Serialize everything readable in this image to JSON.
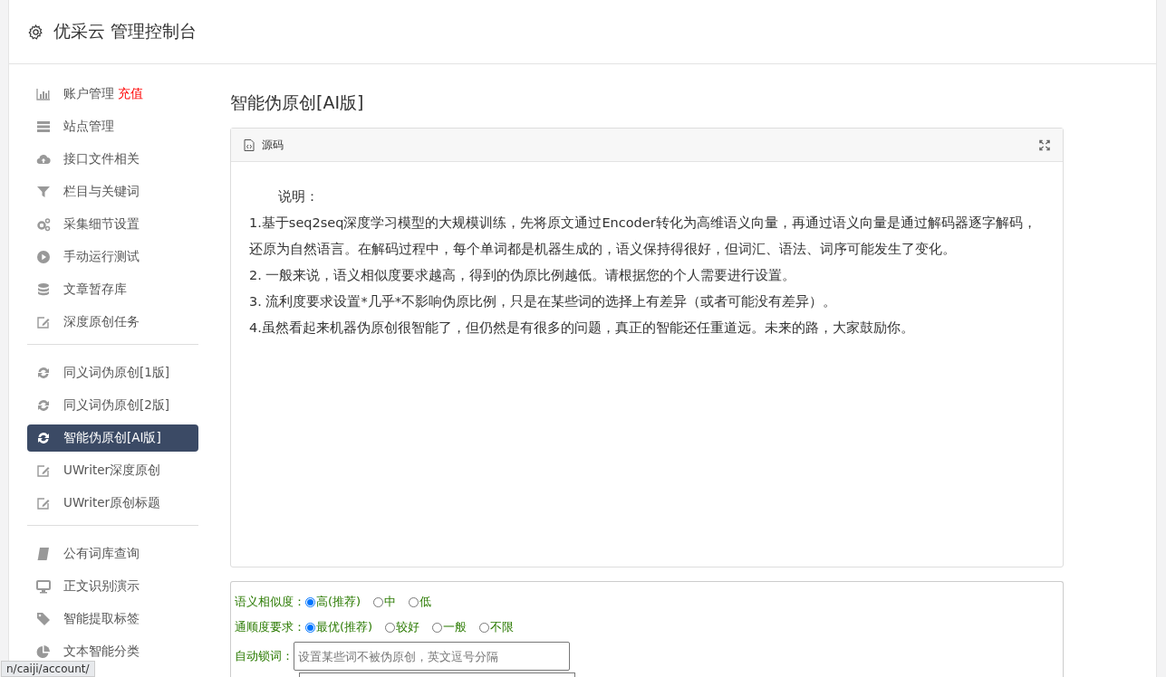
{
  "header": {
    "title": "优采云 管理控制台"
  },
  "sidebar": {
    "groups": [
      {
        "items": [
          {
            "kind": "chart",
            "label": "账户管理",
            "badge": "充值",
            "selected": false
          },
          {
            "kind": "server",
            "label": "站点管理",
            "selected": false
          },
          {
            "kind": "cloud",
            "label": "接口文件相关",
            "selected": false
          },
          {
            "kind": "filter",
            "label": "栏目与关键词",
            "selected": false
          },
          {
            "kind": "gears",
            "label": "采集细节设置",
            "selected": false
          },
          {
            "kind": "play",
            "label": "手动运行测试",
            "selected": false
          },
          {
            "kind": "database",
            "label": "文章暂存库",
            "selected": false
          },
          {
            "kind": "edit",
            "label": "深度原创任务",
            "selected": false
          }
        ]
      },
      {
        "items": [
          {
            "kind": "refresh",
            "label": "同义词伪原创[1版]",
            "selected": false
          },
          {
            "kind": "refresh",
            "label": "同义词伪原创[2版]",
            "selected": false
          },
          {
            "kind": "refresh",
            "label": "智能伪原创[AI版]",
            "selected": true
          },
          {
            "kind": "edit",
            "label": "UWriter深度原创",
            "selected": false
          },
          {
            "kind": "edit",
            "label": "UWriter原创标题",
            "selected": false
          }
        ]
      },
      {
        "items": [
          {
            "kind": "book",
            "label": "公有词库查询",
            "selected": false
          },
          {
            "kind": "monitor",
            "label": "正文识别演示",
            "selected": false
          },
          {
            "kind": "tag",
            "label": "智能提取标签",
            "selected": false
          },
          {
            "kind": "pie",
            "label": "文本智能分类",
            "selected": false
          }
        ]
      }
    ]
  },
  "page_title": "智能伪原创[AI版]",
  "editor": {
    "tab": "源码",
    "heading": "说明：",
    "lines": [
      "1.基于seq2seq深度学习模型的大规模训练，先将原文通过Encoder转化为高维语义向量，再通过语义向量是通过解码器逐字解码，还原为自然语言。在解码过程中，每个单词都是机器生成的，语义保持得很好，但词汇、语法、词序可能发生了变化。",
      "2. 一般来说，语义相似度要求越高，得到的伪原比例越低。请根据您的个人需要进行设置。",
      "3. 流利度要求设置*几乎*不影响伪原比例，只是在某些词的选择上有差异（或者可能没有差异）。",
      "4.虽然看起来机器伪原创很智能了，但仍然是有很多的问题，真正的智能还任重道远。未来的路，大家鼓励你。"
    ]
  },
  "options": {
    "radio_rows": [
      {
        "label": "语义相似度：",
        "choices": [
          {
            "label": "高(推荐)",
            "selected": true
          },
          {
            "label": "中",
            "selected": false
          },
          {
            "label": "低",
            "selected": false
          }
        ]
      },
      {
        "label": "通顺度要求：",
        "choices": [
          {
            "label": "最优(推荐)",
            "selected": true
          },
          {
            "label": "较好",
            "selected": false
          },
          {
            "label": "一般",
            "selected": false
          },
          {
            "label": "不限",
            "selected": false
          }
        ]
      }
    ],
    "lock_words": {
      "label": "自动锁词：",
      "placeholder": "设置某些词不被伪原创，英文逗号分隔"
    }
  },
  "status_url": "n/caiji/account/"
}
